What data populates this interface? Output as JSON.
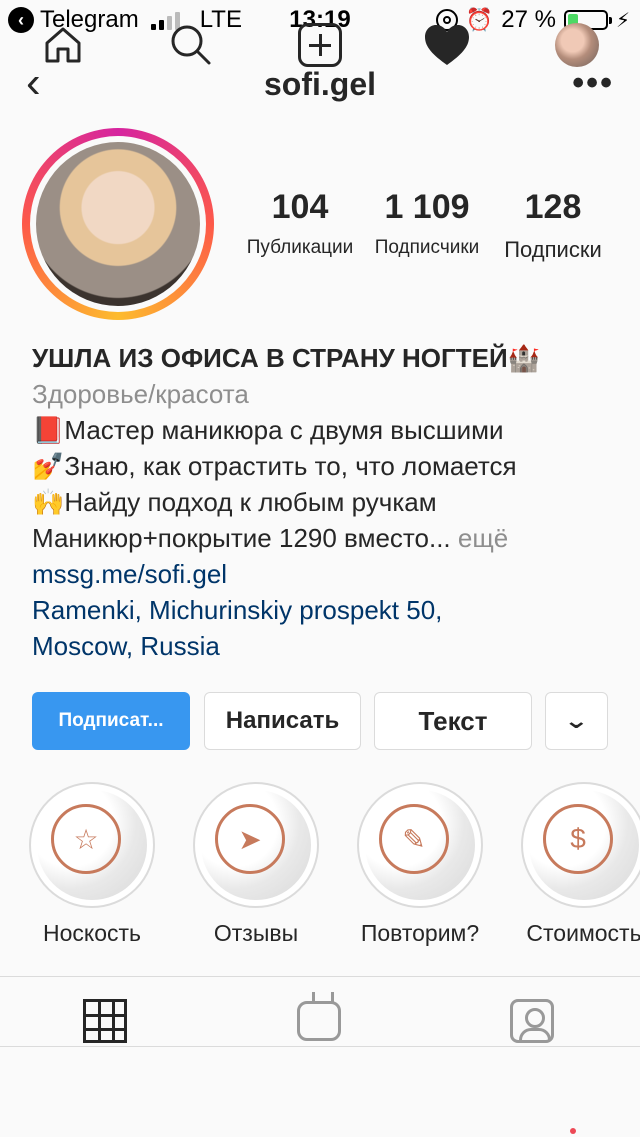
{
  "status_bar": {
    "carrier_back": "Telegram",
    "network": "LTE",
    "time": "13:19",
    "battery": "27 %",
    "battery_level": 0.27
  },
  "header": {
    "username": "sofi.gel",
    "back_icon": "chevron-left-icon",
    "more_icon": "more-dots-icon"
  },
  "stats": [
    {
      "value": "104",
      "label": "Публикации"
    },
    {
      "value": "1 109",
      "label": "Подписчики"
    },
    {
      "value": "128",
      "label": "Подписки"
    }
  ],
  "bio": {
    "name": "УШЛА ИЗ ОФИСА В СТРАНУ НОГТЕЙ🏰",
    "category": "Здоровье/красота",
    "lines": [
      "📕Мастер маникюра с двумя высшими",
      "💅Знаю, как отрастить то, что ломается",
      "🙌Найду подход к любым ручкам",
      "Маникюр+покрытие 1290 вместо..."
    ],
    "more": "ещё",
    "link": "mssg.me/sofi.gel",
    "address_line1": "Ramenki, Michurinskiy prospekt 50,",
    "address_line2": "Moscow, Russia"
  },
  "buttons": {
    "follow": "Подписат...",
    "message": "Написать",
    "text": "Текст",
    "dropdown": "⌄"
  },
  "highlights": [
    {
      "label": "Носкость",
      "icon": "star-icon",
      "glyph": "☆"
    },
    {
      "label": "Отзывы",
      "icon": "send-icon",
      "glyph": "➤"
    },
    {
      "label": "Повторим?",
      "icon": "brush-icon",
      "glyph": "✎"
    },
    {
      "label": "Стоимость",
      "icon": "money-bag-icon",
      "glyph": "$"
    }
  ],
  "colors": {
    "accent": "#3897f0",
    "link": "#003569",
    "highlight_ring": "#c77a5c",
    "notification_dot": "#ed4956"
  }
}
